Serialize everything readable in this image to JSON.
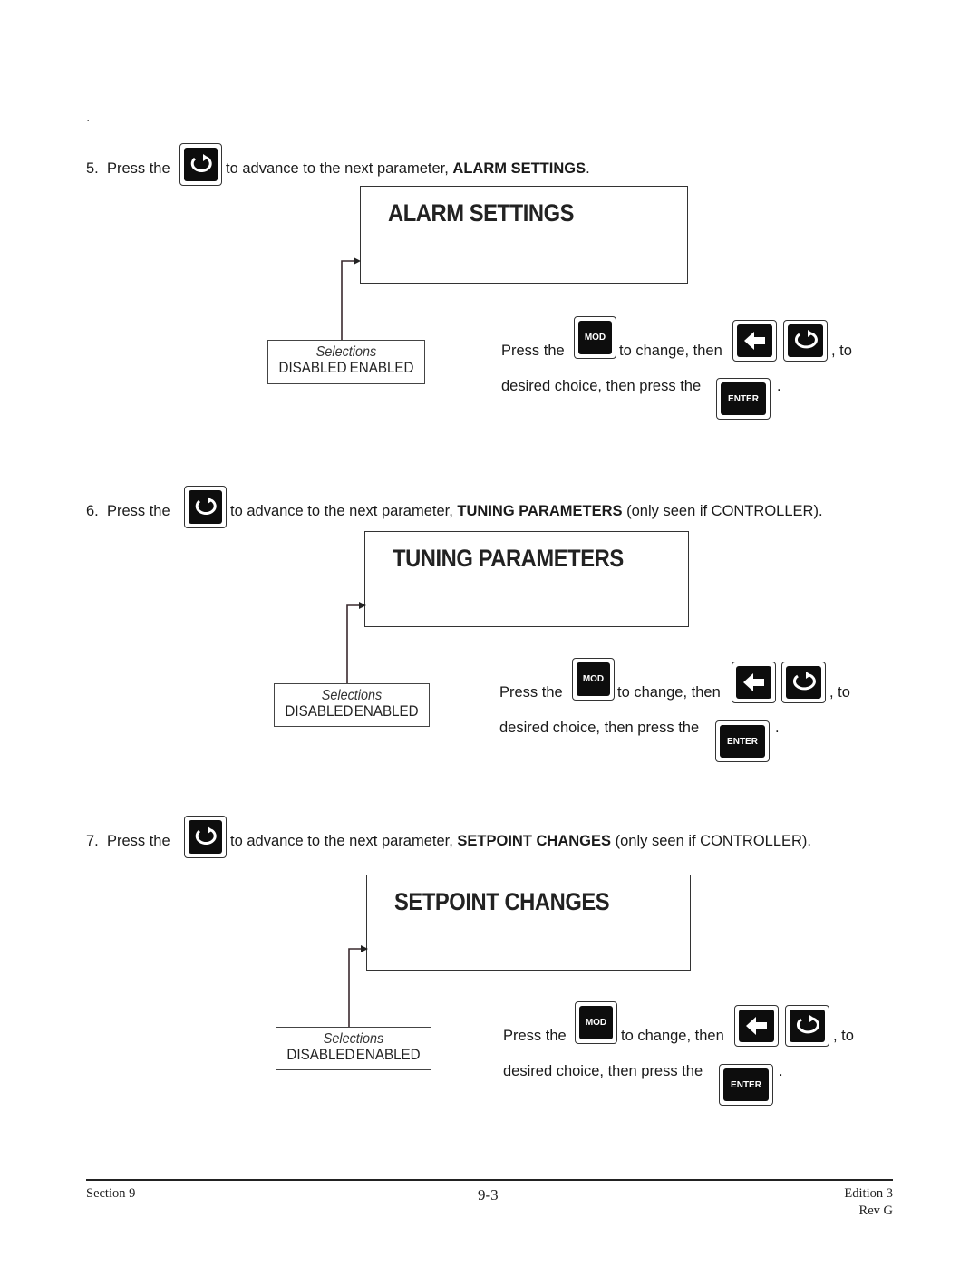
{
  "page": {
    "leading_mark": "."
  },
  "steps": [
    {
      "number": "5.",
      "press": "Press the",
      "advance": "to advance to the next parameter,",
      "parameter": "ALARM SETTINGS",
      "suffix": ".",
      "panel_title": "ALARM  SETTINGS",
      "selections_label": "Selections",
      "options": [
        "DISABLED",
        "ENABLED"
      ],
      "instr_press": "Press  the",
      "instr_change": "to change, then",
      "instr_to": ", to",
      "instr_desired": "desired choice, then press the",
      "instr_end": "."
    },
    {
      "number": "6.",
      "press": "Press the",
      "advance": "to advance to the next parameter,",
      "parameter": "TUNING PARAMETERS",
      "suffix": " (only seen if CONTROLLER).",
      "panel_title": "TUNING PARAMETERS",
      "selections_label": "Selections",
      "options": [
        "DISABLED",
        "ENABLED"
      ],
      "instr_press": "Press  the",
      "instr_change": "to change, then",
      "instr_to": ", to",
      "instr_desired": "desired choice, then press the",
      "instr_end": "."
    },
    {
      "number": "7.",
      "press": "Press the",
      "advance": "to advance to the next parameter,",
      "parameter": "SETPOINT CHANGES",
      "suffix": " (only seen if CONTROLLER).",
      "panel_title": "SETPOINT CHANGES",
      "selections_label": "Selections",
      "options": [
        "DISABLED",
        "ENABLED"
      ],
      "instr_press": "Press  the",
      "instr_change": "to change, then",
      "instr_to": ", to",
      "instr_desired": "desired choice, then press the",
      "instr_end": "."
    }
  ],
  "keys": {
    "mod": "MOD",
    "enter": "ENTER",
    "scroll_icon": "scroll-cycle-icon",
    "left_icon": "left-arrow-icon"
  },
  "footer": {
    "section": "Section 9",
    "page": "9-3",
    "edition": "Edition 3",
    "rev": "Rev G"
  }
}
